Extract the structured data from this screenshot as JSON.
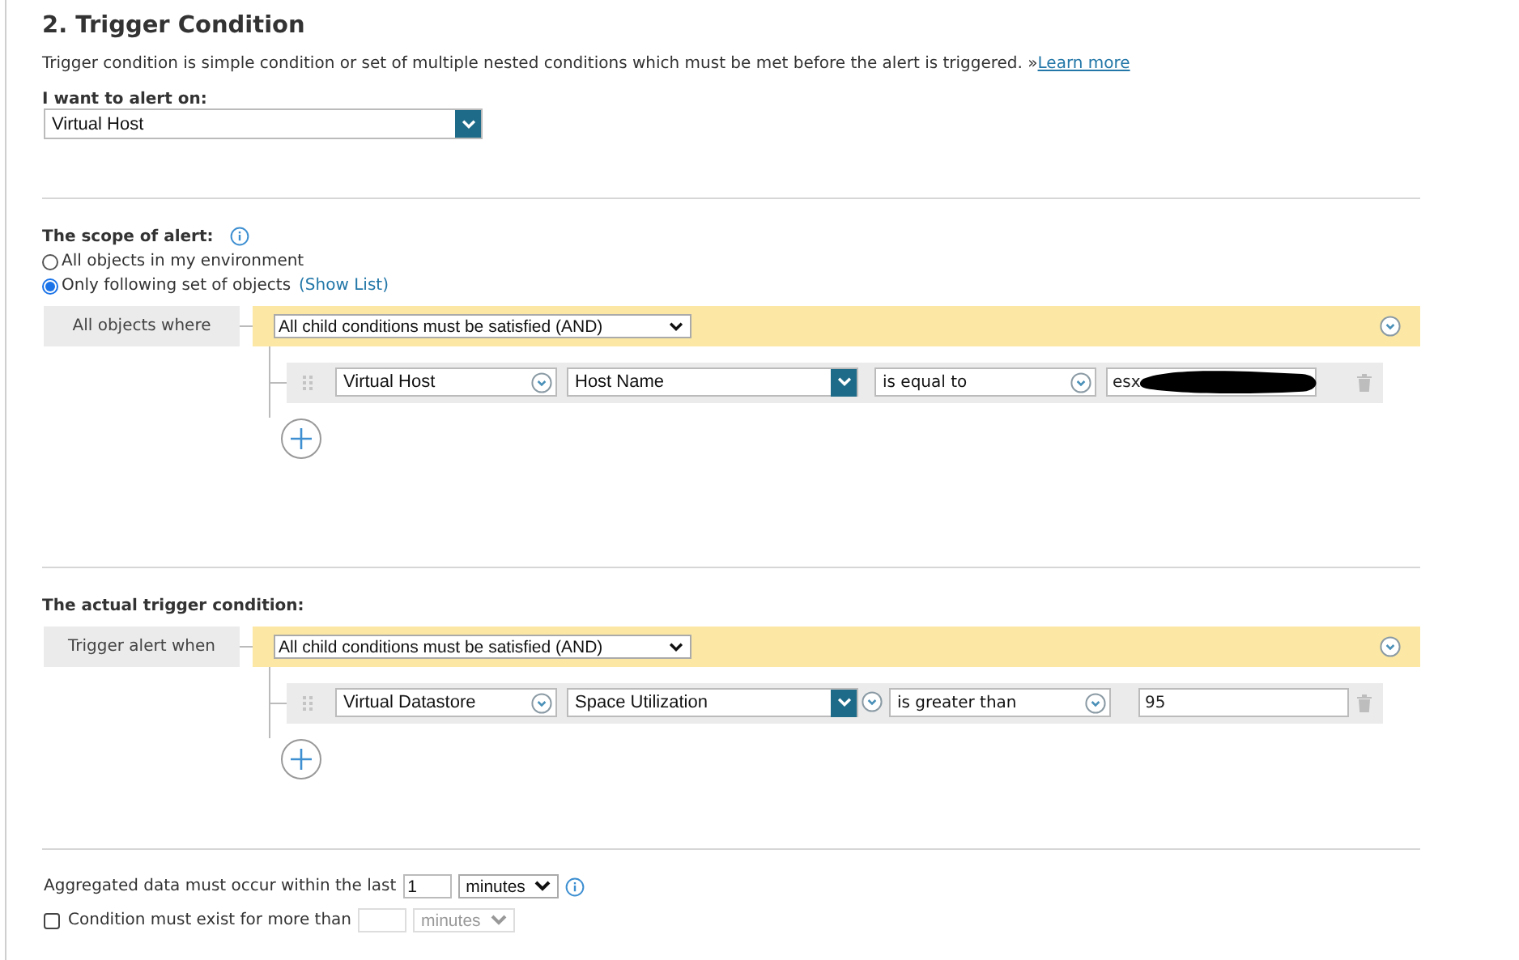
{
  "section": {
    "title": "2. Trigger Condition",
    "description": "Trigger condition is simple condition or set of multiple nested conditions which must be met before the alert is triggered. »",
    "link": "Learn more"
  },
  "alert_on": {
    "label": "I want to alert on:",
    "value": "Virtual Host"
  },
  "scope": {
    "label": "The scope of alert:",
    "options": [
      {
        "label": "All objects in my environment",
        "selected": false
      },
      {
        "label": "Only following set of objects",
        "selected": true,
        "link": "(Show List)"
      }
    ]
  },
  "scope_group": {
    "label": "All objects where",
    "operator": "All child conditions must be satisfied (AND)",
    "conditions": [
      {
        "object": "Virtual Host",
        "field": "Host Name",
        "field_toggle": false,
        "comparison": "is equal to",
        "value": "esx",
        "redacted": true
      }
    ]
  },
  "trigger": {
    "label": "The actual trigger condition:"
  },
  "trigger_group": {
    "label": "Trigger alert when",
    "operator": "All child conditions must be satisfied (AND)",
    "conditions": [
      {
        "object": "Virtual Datastore",
        "field": "Space Utilization",
        "field_toggle": true,
        "comparison": "is greater than",
        "value": "95",
        "redacted": false
      }
    ]
  },
  "aggregation": {
    "label": "Aggregated data must occur within the last",
    "value": "1",
    "unit": "minutes"
  },
  "duration": {
    "label": "Condition must exist for more than",
    "checked": false,
    "disabled": true,
    "unit": "minutes"
  }
}
